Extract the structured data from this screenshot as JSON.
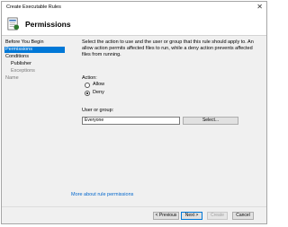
{
  "window": {
    "title": "Create Executable Rules",
    "close_glyph": "✕"
  },
  "header": {
    "title": "Permissions",
    "icon": "rule-wizard-icon"
  },
  "nav": {
    "items": [
      {
        "label": "Before You Begin",
        "state": "normal"
      },
      {
        "label": "Permissions",
        "state": "selected"
      },
      {
        "label": "Conditions",
        "state": "normal"
      },
      {
        "label": "Publisher",
        "state": "normal"
      },
      {
        "label": "Exceptions",
        "state": "dim"
      },
      {
        "label": "Name",
        "state": "dim"
      }
    ]
  },
  "content": {
    "description": "Select the action to use and the user or group that this rule should apply to. An allow action permits affected files to run, while a deny action prevents affected files from running.",
    "action_label": "Action:",
    "action_options": [
      {
        "label": "Allow",
        "selected": false
      },
      {
        "label": "Deny",
        "selected": true
      }
    ],
    "user_group_label": "User or group:",
    "user_group_value": "Everyone",
    "select_button": "Select...",
    "more_link": "More about rule permissions"
  },
  "footer": {
    "previous": "< Previous",
    "next": "Next >",
    "create": "Create",
    "cancel": "Cancel"
  },
  "colors": {
    "accent": "#0078d7",
    "link": "#0066cc",
    "window_bg": "#f0f0f0"
  }
}
